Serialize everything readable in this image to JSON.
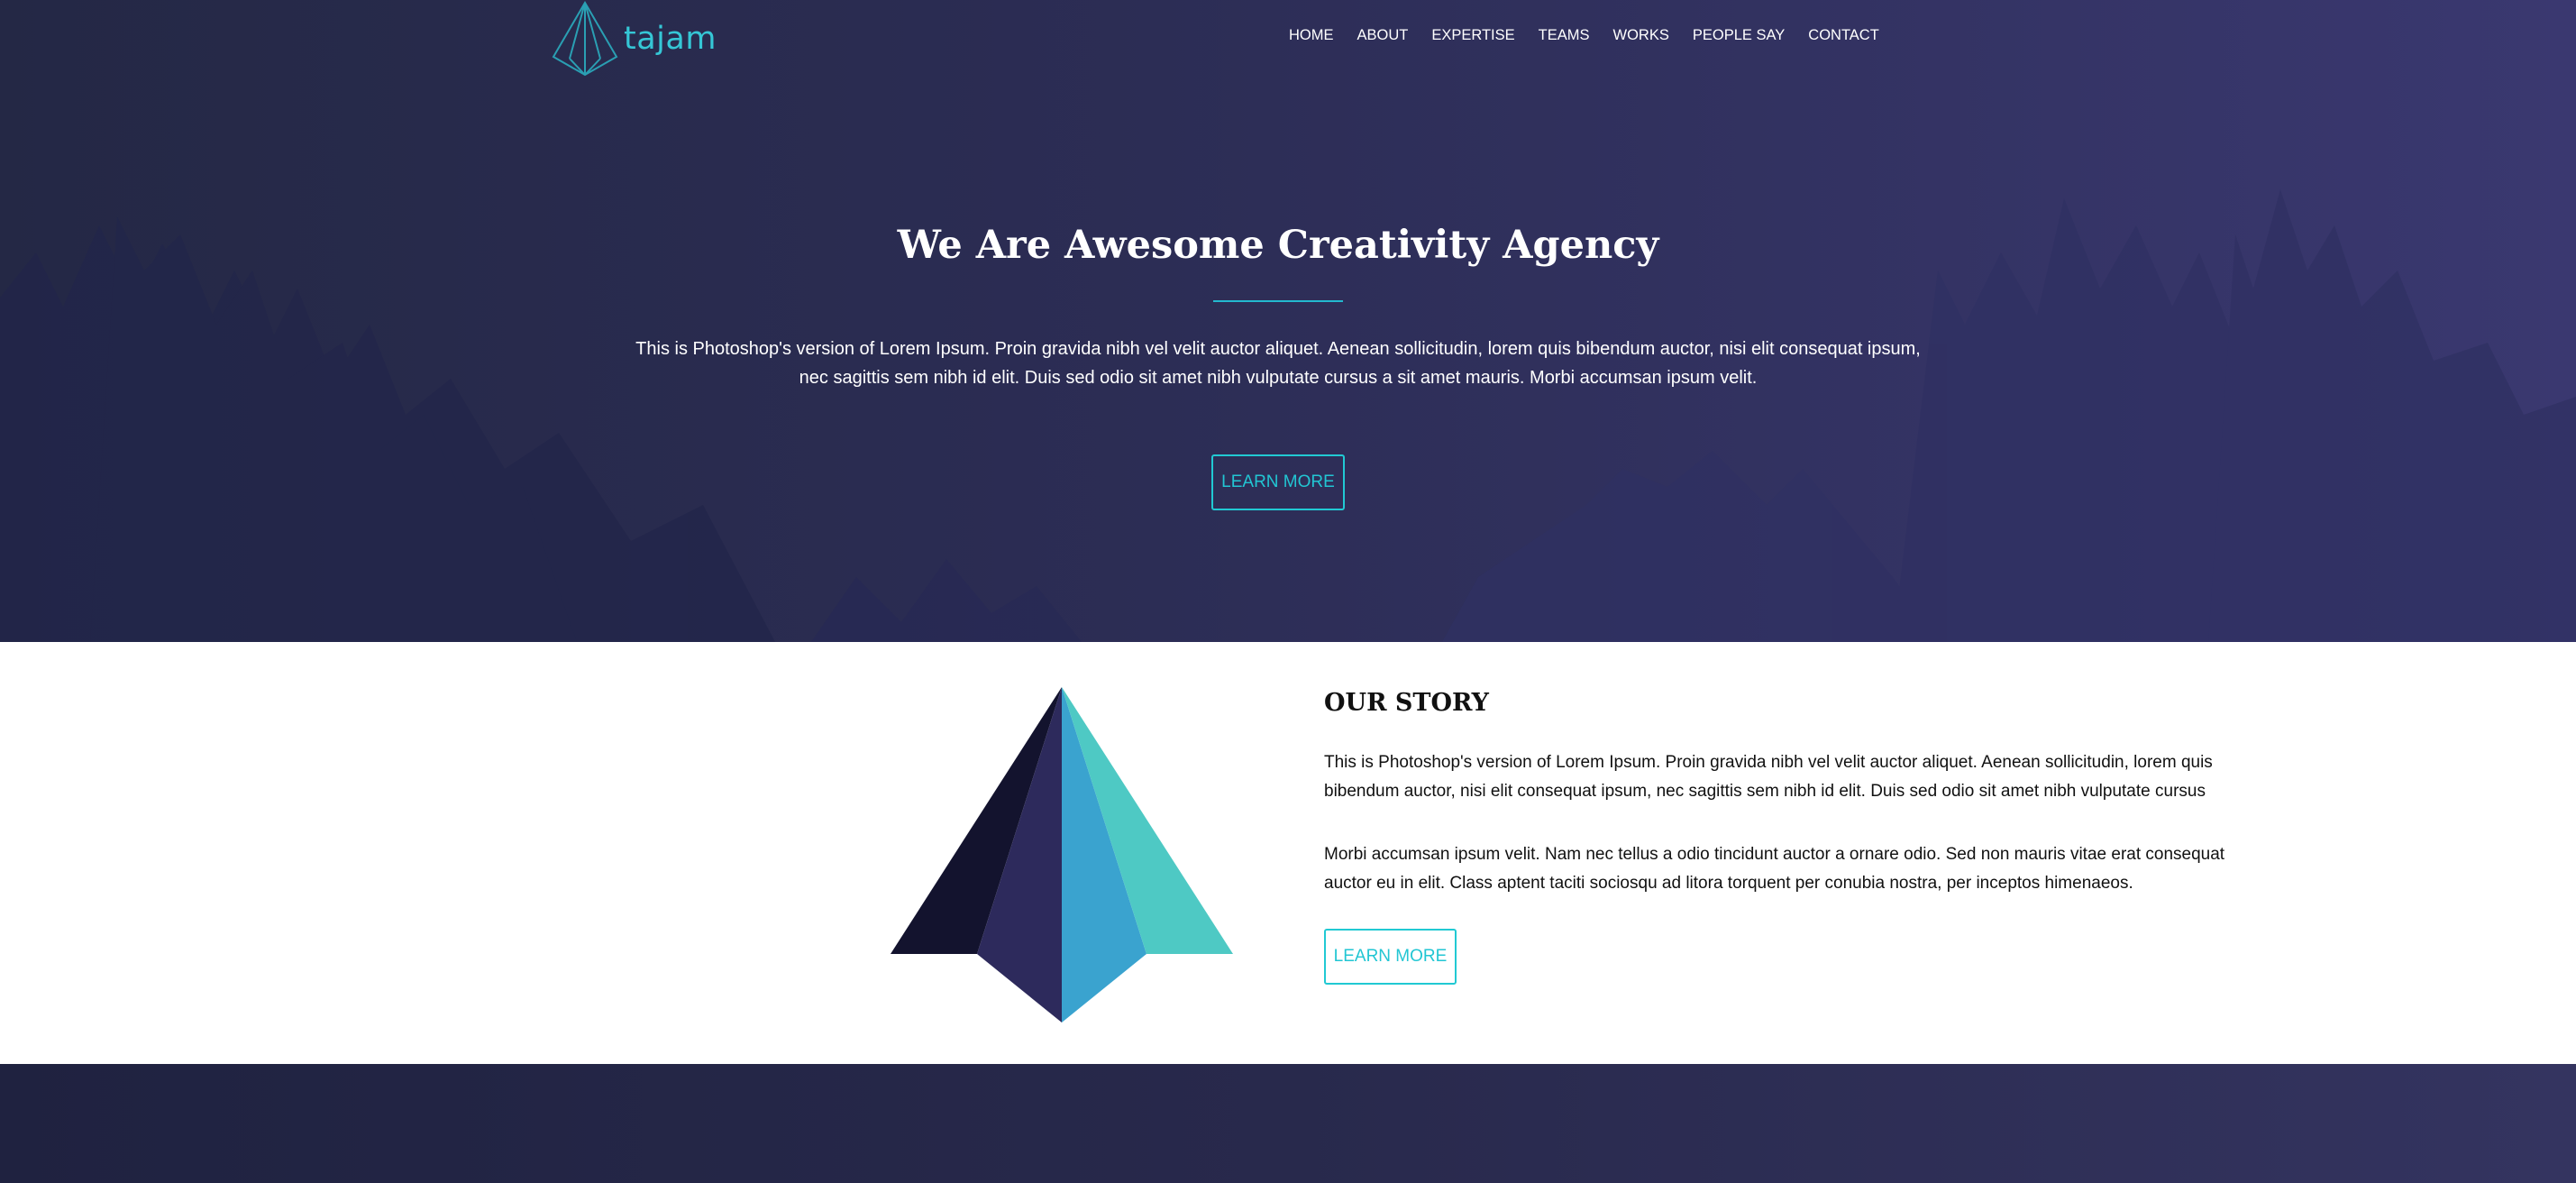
{
  "brand": {
    "name": "tajam",
    "logo_icon": "paper-plane-pyramid-icon",
    "accent_color": "#23b9cf"
  },
  "nav": {
    "items": [
      "HOME",
      "ABOUT",
      "EXPERTISE",
      "TEAMS",
      "WORKS",
      "PEOPLE SAY",
      "CONTACT"
    ]
  },
  "hero": {
    "title": "We Are Awesome Creativity Agency",
    "text": "This is Photoshop's version of Lorem Ipsum. Proin gravida nibh vel velit auctor aliquet. Aenean sollicitudin, lorem quis bibendum auctor, nisi elit consequat ipsum, nec sagittis sem nibh id elit. Duis sed odio sit amet nibh vulputate cursus a sit amet mauris. Morbi accumsan ipsum velit.",
    "button_label": "LEARN MORE",
    "background": "forest-silhouette-image"
  },
  "story": {
    "title": "OUR STORY",
    "paragraph1": "This is Photoshop's version of Lorem Ipsum. Proin gravida nibh vel velit auctor aliquet. Aenean sollicitudin, lorem quis bibendum auctor, nisi elit consequat ipsum, nec sagittis sem nibh id elit. Duis sed odio sit amet nibh vulputate cursus",
    "paragraph2": "Morbi accumsan ipsum velit. Nam nec tellus a odio tincidunt auctor a ornare odio. Sed non mauris vitae erat consequat auctor eu in elit. Class aptent taciti sociosqu ad litora torquent per conubia nostra, per inceptos himenaeos.",
    "button_label": "LEARN MORE",
    "illustration": "pyramid-illustration",
    "pyramid_colors": [
      "#13132e",
      "#2d2a5c",
      "#3aa3cf",
      "#4ec9c4"
    ]
  }
}
